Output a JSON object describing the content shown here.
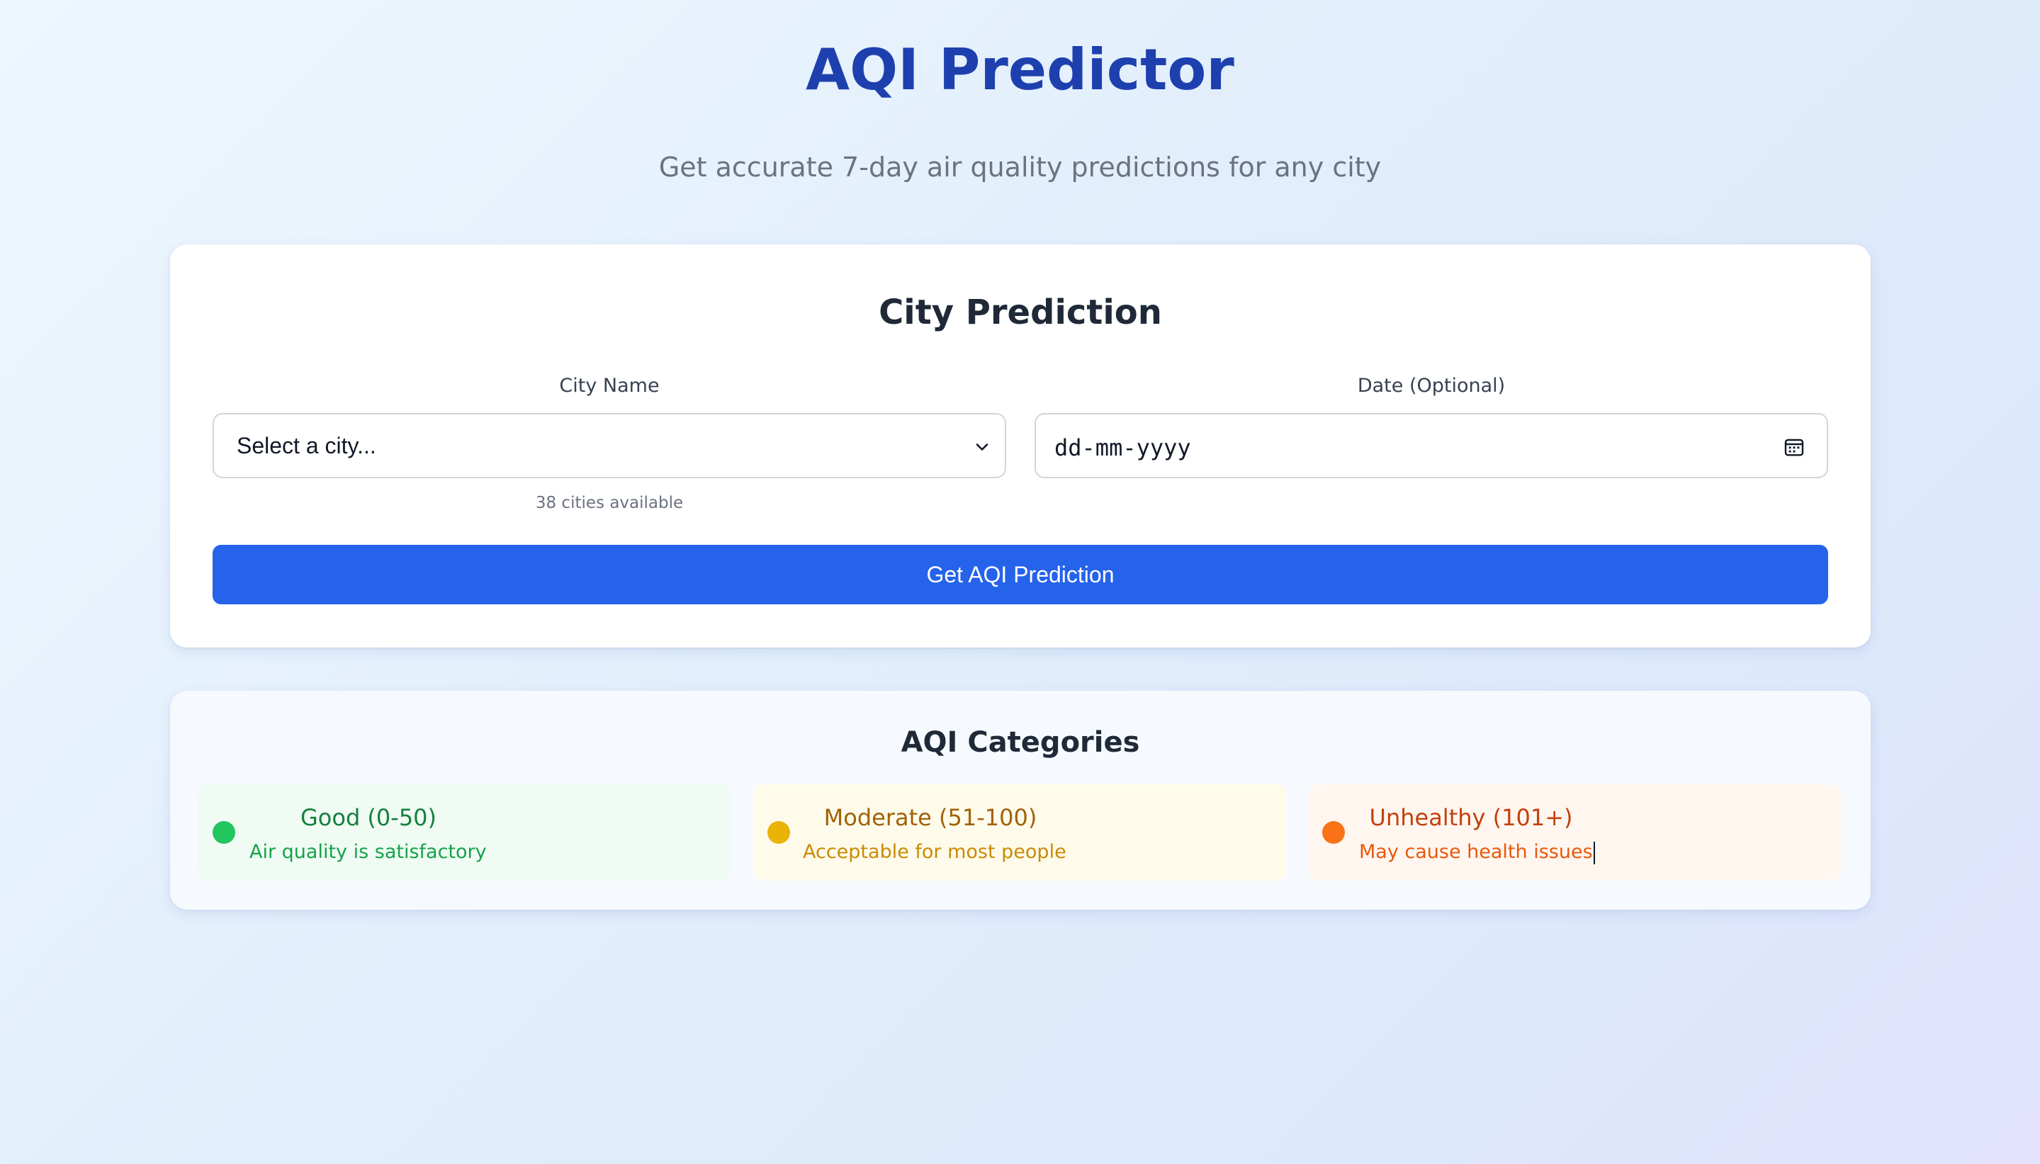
{
  "header": {
    "title": "AQI Predictor",
    "subtitle": "Get accurate 7-day air quality predictions for any city"
  },
  "prediction": {
    "title": "City Prediction",
    "city_label": "City Name",
    "city_selected": "Select a city...",
    "cities_hint": "38 cities available",
    "date_label": "Date (Optional)",
    "date_placeholder": "dd-mm-yyyy",
    "submit_label": "Get AQI Prediction"
  },
  "categories": {
    "title": "AQI Categories",
    "items": [
      {
        "name": "Good (0-50)",
        "desc": "Air quality is satisfactory",
        "color": "#22c55e"
      },
      {
        "name": "Moderate (51-100)",
        "desc": "Acceptable for most people",
        "color": "#eab308"
      },
      {
        "name": "Unhealthy (101+)",
        "desc": "May cause health issues",
        "color": "#f97316"
      }
    ]
  },
  "colors": {
    "accent": "#2563eb",
    "title": "#1e40af"
  },
  "icons": {
    "select": "chevron-down-icon",
    "date": "calendar-icon"
  }
}
